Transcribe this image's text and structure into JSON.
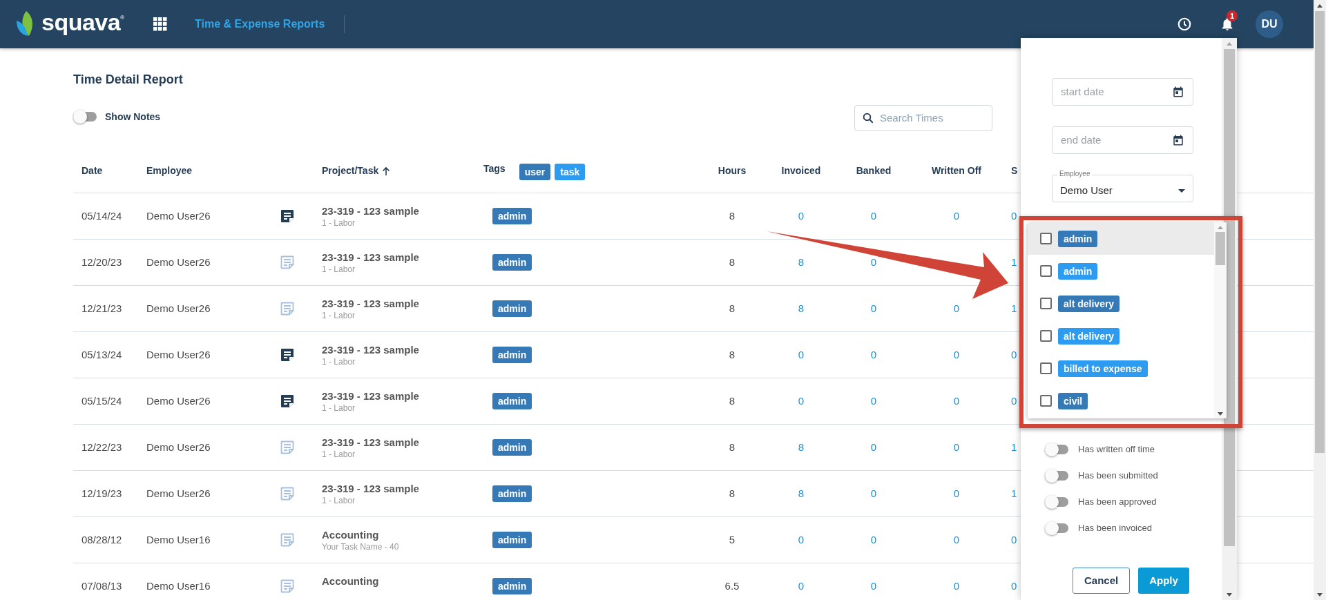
{
  "header": {
    "brand": "squava",
    "brand_mark": "®",
    "app_title": "Time & Expense Reports",
    "notification_count": "1",
    "avatar_initials": "DU"
  },
  "report": {
    "title": "Time Detail Report",
    "show_notes": {
      "label": "Show Notes",
      "on": false
    },
    "search": {
      "placeholder": "Search Times"
    }
  },
  "table": {
    "columns": [
      {
        "label": "Date",
        "sorted": false
      },
      {
        "label": "Employee",
        "sorted": false
      },
      {
        "label": "Project/Task",
        "sorted": true
      },
      {
        "label": "Tags",
        "sorted": false
      },
      {
        "label": "Hours",
        "sorted": false
      },
      {
        "label": "Invoiced",
        "sorted": false
      },
      {
        "label": "Banked",
        "sorted": false
      },
      {
        "label": "Written Off",
        "sorted": false
      },
      {
        "label": "S",
        "sorted": false
      }
    ],
    "tag_chips": [
      {
        "label": "user",
        "color": "#3579b7"
      },
      {
        "label": "task",
        "color": "#2d9bf0"
      }
    ],
    "rows": [
      {
        "date": "05/14/24",
        "employee": "Demo User26",
        "has_notes": true,
        "project": "23-319 - 123 sample",
        "task": "1 - Labor",
        "tag": {
          "label": "admin",
          "color": "#3579b7"
        },
        "hours": "8",
        "invoiced": "0",
        "banked": "0",
        "written_off": "0",
        "column_10": "0"
      },
      {
        "date": "12/20/23",
        "employee": "Demo User26",
        "has_notes": false,
        "project": "23-319 - 123 sample",
        "task": "1 - Labor",
        "tag": {
          "label": "admin",
          "color": "#3579b7"
        },
        "hours": "8",
        "invoiced": "8",
        "banked": "0",
        "column_10": "1"
      },
      {
        "date": "12/21/23",
        "employee": "Demo User26",
        "has_notes": false,
        "project": "23-319 - 123 sample",
        "task": "1 - Labor",
        "tag": {
          "label": "admin",
          "color": "#3579b7"
        },
        "hours": "8",
        "invoiced": "8",
        "banked": "0",
        "written_off": "0",
        "column_10": "1"
      },
      {
        "date": "05/13/24",
        "employee": "Demo User26",
        "has_notes": true,
        "project": "23-319 - 123 sample",
        "task": "1 - Labor",
        "tag": {
          "label": "admin",
          "color": "#3579b7"
        },
        "hours": "8",
        "invoiced": "0",
        "banked": "0",
        "written_off": "0",
        "column_10": "0"
      },
      {
        "date": "05/15/24",
        "employee": "Demo User26",
        "has_notes": true,
        "project": "23-319 - 123 sample",
        "task": "1 - Labor",
        "tag": {
          "label": "admin",
          "color": "#3579b7"
        },
        "hours": "8",
        "invoiced": "0",
        "banked": "0",
        "written_off": "0",
        "column_10": "0"
      },
      {
        "date": "12/22/23",
        "employee": "Demo User26",
        "has_notes": false,
        "project": "23-319 - 123 sample",
        "task": "1 - Labor",
        "tag": {
          "label": "admin",
          "color": "#3579b7"
        },
        "hours": "8",
        "invoiced": "8",
        "banked": "0",
        "written_off": "0",
        "column_10": "1"
      },
      {
        "date": "12/19/23",
        "employee": "Demo User26",
        "has_notes": false,
        "project": "23-319 - 123 sample",
        "task": "1 - Labor",
        "tag": {
          "label": "admin",
          "color": "#3579b7"
        },
        "hours": "8",
        "invoiced": "8",
        "banked": "0",
        "written_off": "0",
        "column_10": "1"
      },
      {
        "date": "08/28/12",
        "employee": "Demo User16",
        "has_notes": false,
        "project": "Accounting",
        "task": "Your Task Name - 40",
        "tag": {
          "label": "admin",
          "color": "#3579b7"
        },
        "hours": "5",
        "invoiced": "0",
        "banked": "0",
        "written_off": "0",
        "column_10": "0"
      },
      {
        "date": "07/08/13",
        "employee": "Demo User16",
        "has_notes": false,
        "project": "Accounting",
        "tag": {
          "label": "admin",
          "color": "#3579b7"
        },
        "hours": "6.5",
        "invoiced": "0",
        "banked": "0",
        "written_off": "0",
        "column_10": "0"
      }
    ]
  },
  "filter_panel": {
    "start_date": {
      "placeholder": "start date"
    },
    "end_date": {
      "placeholder": "end date"
    },
    "employee": {
      "label": "Employee",
      "value": "Demo User"
    },
    "tag_options": [
      {
        "label": "admin",
        "color": "#3579b7",
        "checked": false,
        "highlighted": true
      },
      {
        "label": "admin",
        "color": "#2d9bf0",
        "checked": false,
        "highlighted": false
      },
      {
        "label": "alt delivery",
        "color": "#3579b7",
        "checked": false,
        "highlighted": false
      },
      {
        "label": "alt delivery",
        "color": "#2d9bf0",
        "checked": false,
        "highlighted": false
      },
      {
        "label": "billed to expense",
        "color": "#2d9bf0",
        "checked": false,
        "highlighted": false
      },
      {
        "label": "civil",
        "color": "#3579b7",
        "checked": false,
        "highlighted": false
      }
    ],
    "toggles": [
      {
        "label": "Has written off time",
        "on": false
      },
      {
        "label": "Has been submitted",
        "on": false
      },
      {
        "label": "Has been approved",
        "on": false
      },
      {
        "label": "Has been invoiced",
        "on": false
      }
    ],
    "buttons": [
      {
        "label": "Cancel",
        "kind": "secondary"
      },
      {
        "label": "Apply",
        "kind": "primary"
      }
    ]
  }
}
